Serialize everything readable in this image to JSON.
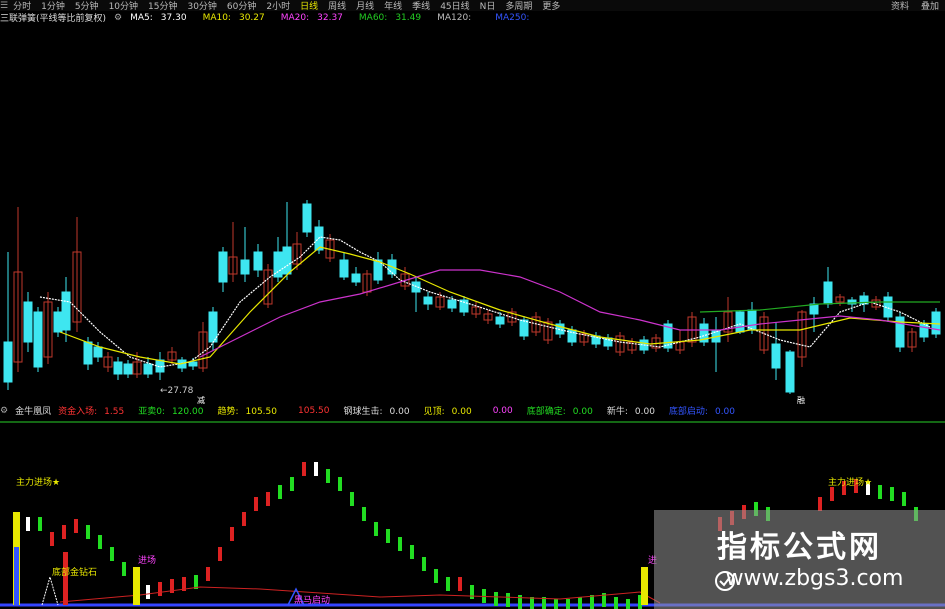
{
  "toolbar": {
    "menu_icon": "menu-icon",
    "tabs": [
      "分时",
      "1分钟",
      "5分钟",
      "10分钟",
      "15分钟",
      "30分钟",
      "60分钟",
      "2小时",
      "日线",
      "周线",
      "月线",
      "年线",
      "季线",
      "45日线",
      "N日",
      "多周期",
      "更多"
    ],
    "active_tab": "日线",
    "right_items": [
      "资料",
      "叠加"
    ]
  },
  "ma_legend": {
    "title": "三联弹簧(平线等比前复权)",
    "items": [
      {
        "label": "MA5:",
        "value": "37.30",
        "color": "#ffffff"
      },
      {
        "label": "MA10:",
        "value": "30.27",
        "color": "#e8e800"
      },
      {
        "label": "MA20:",
        "value": "32.37",
        "color": "#ff44ff"
      },
      {
        "label": "MA60:",
        "value": "31.49",
        "color": "#22cc22"
      },
      {
        "label": "MA120:",
        "value": "",
        "color": "#bbbbbb"
      },
      {
        "label": "MA250:",
        "value": "",
        "color": "#3355ff"
      }
    ]
  },
  "main_chart": {
    "low_marker": "←27.78",
    "mark_a": "减",
    "mark_b": "融"
  },
  "indicator_bar": {
    "name": "金牛凰凤",
    "items": [
      {
        "label": "资金入场:",
        "value": "1.55",
        "color": "#ff3333"
      },
      {
        "label": "亚卖0:",
        "value": "120.00",
        "color": "#22dd22"
      },
      {
        "label": "趋势:",
        "value": "105.50",
        "color": "#e8e800"
      },
      {
        "label": "",
        "value": "105.50",
        "color": "#ff3333"
      },
      {
        "label": "钢球生击:",
        "value": "0.00",
        "color": "#dddddd"
      },
      {
        "label": "见顶:",
        "value": "0.00",
        "color": "#e8e800"
      },
      {
        "label": "",
        "value": "0.00",
        "color": "#ff44ff"
      },
      {
        "label": "底部确定:",
        "value": "0.00",
        "color": "#22dd22"
      },
      {
        "label": "新牛:",
        "value": "0.00",
        "color": "#dddddd"
      },
      {
        "label": "底部启动:",
        "value": "0.00",
        "color": "#3355ff"
      }
    ]
  },
  "sub_chart": {
    "label1": "主力进场★",
    "label2": "底部金钻石",
    "label3": "进场",
    "label4": "黑马启动",
    "label5": "主力进场★",
    "label6": "进"
  },
  "watermark": {
    "title": "指标公式网",
    "url": "www.zbgs3.com"
  }
}
